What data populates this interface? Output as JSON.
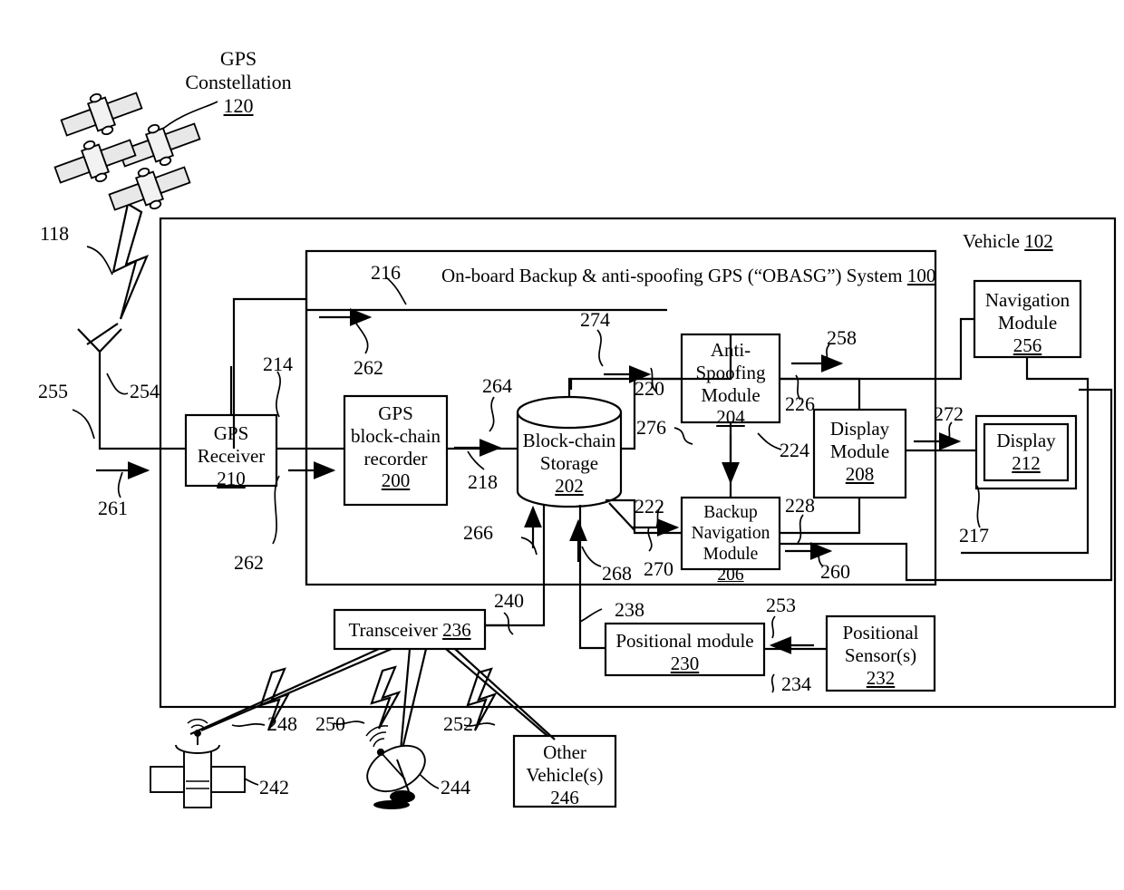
{
  "figure": {
    "type": "patent-block-diagram",
    "vehicle_label": "Vehicle",
    "vehicle_ref": "102",
    "system_title": "On-board Backup & anti-spoofing GPS (“OBASG”) System",
    "system_ref": "100",
    "gps_constellation_label_line1": "GPS",
    "gps_constellation_label_line2": "Constellation",
    "gps_constellation_ref": "120"
  },
  "blocks": {
    "gps_receiver": {
      "lines": [
        "GPS",
        "Receiver"
      ],
      "ref": "210"
    },
    "gps_bc_recorder": {
      "lines": [
        "GPS",
        "block-chain",
        "recorder"
      ],
      "ref": "200"
    },
    "blockchain_storage": {
      "lines": [
        "Block-chain",
        "Storage"
      ],
      "ref": "202"
    },
    "anti_spoofing": {
      "lines": [
        "Anti-",
        "Spoofing",
        "Module"
      ],
      "ref": "204"
    },
    "backup_navigation": {
      "lines": [
        "Backup",
        "Navigation",
        "Module"
      ],
      "ref": "206"
    },
    "display_module": {
      "lines": [
        "Display",
        "Module"
      ],
      "ref": "208"
    },
    "display": {
      "lines": [
        "Display"
      ],
      "ref": "212"
    },
    "navigation_module": {
      "lines": [
        "Navigation",
        "Module"
      ],
      "ref": "256"
    },
    "transceiver": {
      "inline": "Transceiver",
      "ref": "236"
    },
    "positional_module": {
      "inline": "Positional module",
      "ref": "230"
    },
    "positional_sensors": {
      "lines": [
        "Positional",
        "Sensor(s)"
      ],
      "ref": "232"
    },
    "other_vehicles": {
      "lines": [
        "Other",
        "Vehicle(s)"
      ],
      "ref": "246"
    }
  },
  "reference_numerals": [
    {
      "id": "118",
      "text": "118"
    },
    {
      "id": "255",
      "text": "255"
    },
    {
      "id": "254",
      "text": "254"
    },
    {
      "id": "261",
      "text": "261"
    },
    {
      "id": "214",
      "text": "214"
    },
    {
      "id": "262a",
      "text": "262"
    },
    {
      "id": "262b",
      "text": "262"
    },
    {
      "id": "216",
      "text": "216"
    },
    {
      "id": "264",
      "text": "264"
    },
    {
      "id": "218",
      "text": "218"
    },
    {
      "id": "266",
      "text": "266"
    },
    {
      "id": "268",
      "text": "268"
    },
    {
      "id": "270",
      "text": "270"
    },
    {
      "id": "274",
      "text": "274"
    },
    {
      "id": "220",
      "text": "220"
    },
    {
      "id": "276",
      "text": "276"
    },
    {
      "id": "222",
      "text": "222"
    },
    {
      "id": "224",
      "text": "224"
    },
    {
      "id": "226",
      "text": "226"
    },
    {
      "id": "228",
      "text": "228"
    },
    {
      "id": "258",
      "text": "258"
    },
    {
      "id": "260",
      "text": "260"
    },
    {
      "id": "272",
      "text": "272"
    },
    {
      "id": "217",
      "text": "217"
    },
    {
      "id": "240",
      "text": "240"
    },
    {
      "id": "238",
      "text": "238"
    },
    {
      "id": "253",
      "text": "253"
    },
    {
      "id": "234",
      "text": "234"
    },
    {
      "id": "248",
      "text": "248"
    },
    {
      "id": "250",
      "text": "250"
    },
    {
      "id": "252",
      "text": "252"
    },
    {
      "id": "242",
      "text": "242"
    },
    {
      "id": "244",
      "text": "244"
    }
  ],
  "icons": {
    "satellites": "gps-satellite-icon",
    "antenna": "dipole-antenna-icon",
    "lightning": "rf-signal-lightning-icon",
    "ground_satellite": "communication-satellite-icon",
    "dish": "satellite-dish-icon"
  },
  "colors": {
    "line": "#000000",
    "background": "#ffffff"
  }
}
